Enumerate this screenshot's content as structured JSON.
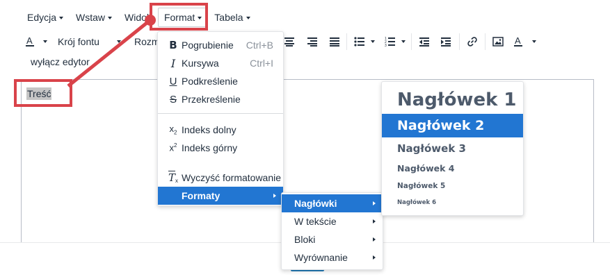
{
  "menubar": {
    "items": [
      {
        "label": "Edycja"
      },
      {
        "label": "Wstaw"
      },
      {
        "label": "Widok"
      },
      {
        "label": "Format"
      },
      {
        "label": "Tabela"
      }
    ]
  },
  "toolbar": {
    "font_family_label": "Krój fontu",
    "font_size_label": "Rozm"
  },
  "toolbar2": {
    "disable_editor_label": "wyłącz edytor"
  },
  "editor": {
    "content": "Treść"
  },
  "format_menu": {
    "items": [
      {
        "label": "Pogrubienie",
        "shortcut": "Ctrl+B",
        "icon": "bold-icon"
      },
      {
        "label": "Kursywa",
        "shortcut": "Ctrl+I",
        "icon": "italic-icon"
      },
      {
        "label": "Podkreślenie",
        "icon": "underline-icon"
      },
      {
        "label": "Przekreślenie",
        "icon": "strikethrough-icon"
      },
      {
        "label": "Indeks dolny",
        "icon": "subscript-icon"
      },
      {
        "label": "Indeks górny",
        "icon": "superscript-icon"
      },
      {
        "label": "Wyczyść formatowanie",
        "icon": "clear-formatting-icon"
      },
      {
        "label": "Formaty",
        "active": true
      }
    ]
  },
  "formats_submenu": {
    "items": [
      {
        "label": "Nagłówki",
        "active": true
      },
      {
        "label": "W tekście"
      },
      {
        "label": "Bloki"
      },
      {
        "label": "Wyrównanie"
      }
    ]
  },
  "headings_submenu": {
    "items": [
      {
        "label": "Nagłówek 1"
      },
      {
        "label": "Nagłówek 2",
        "active": true
      },
      {
        "label": "Nagłówek 3"
      },
      {
        "label": "Nagłówek 4"
      },
      {
        "label": "Nagłówek 5"
      },
      {
        "label": "Nagłówek 6"
      }
    ]
  },
  "colors": {
    "accent": "#2276d2",
    "annotation": "#d9434a",
    "text": "#222f3e"
  }
}
